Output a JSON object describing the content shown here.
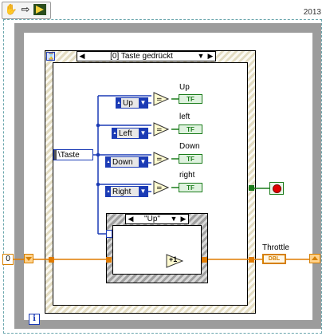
{
  "toolbar": {
    "year": "2013",
    "icons": [
      "hand-icon",
      "arrow-right-icon",
      "run-icon"
    ]
  },
  "structure": {
    "case_selector": "[0] Taste gedrückt",
    "inner_case_selector": "\"Up\""
  },
  "terminal": {
    "taste_label": "\\Taste"
  },
  "rings": [
    {
      "label": "Up"
    },
    {
      "label": "Left"
    },
    {
      "label": "Down"
    },
    {
      "label": "Right"
    }
  ],
  "indicators": [
    {
      "label": "Up",
      "type": "TF"
    },
    {
      "label": "left",
      "type": "TF"
    },
    {
      "label": "Down",
      "type": "TF"
    },
    {
      "label": "right",
      "type": "TF"
    }
  ],
  "throttle": {
    "label": "Throttle",
    "type": "DBL",
    "init_constant": "0",
    "increment": "+1"
  },
  "colors": {
    "boolean": "#1b7c1b",
    "enum": "#1b3bb5",
    "numeric": "#e07b00",
    "stop": "#e00000"
  }
}
